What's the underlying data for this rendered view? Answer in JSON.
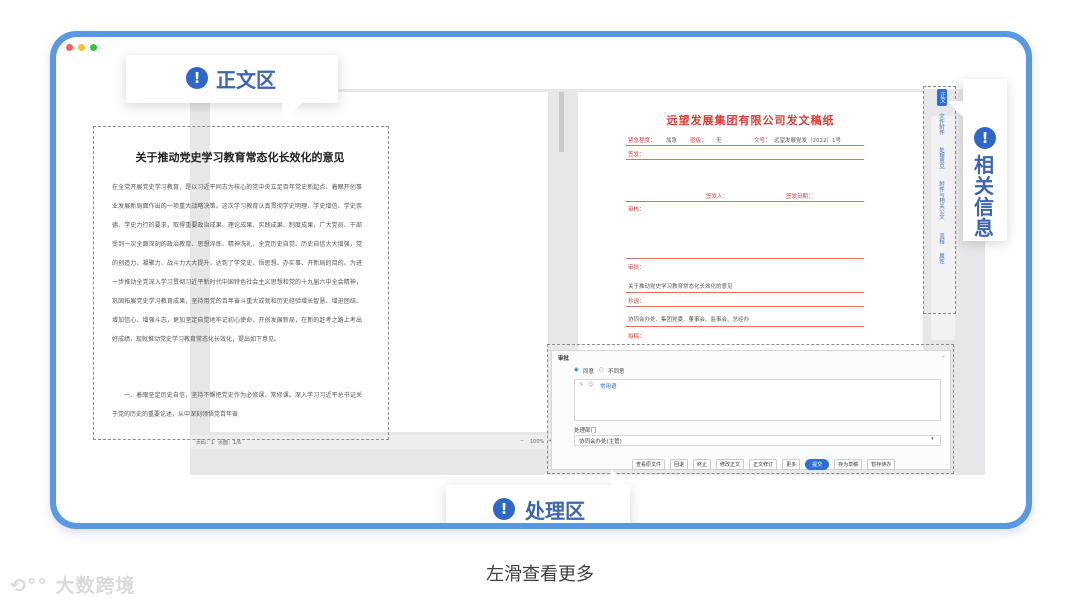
{
  "callouts": {
    "main": "正文区",
    "related": "相关信息",
    "process": "处理区"
  },
  "caption": "左滑查看更多",
  "watermark": "大数跨境",
  "doc": {
    "title": "关于推动党史学习教育常态化长效化的意见",
    "paragraphs": [
      "在全党开展党史学习教育，是以习近平同志为核心的党中央立足百年党史新起点、着眼开创事业发展新局面作出的一项重大战略决策。这次学习教育认真贯彻学史明理、学史增信、学史崇德、学史力行的要求，取得重要政治成果、理论成果、实践成果、制度成果，广大党员、干部受到一次全面深刻的政治教育、思想淬炼、精神洗礼，全党历史自觉、历史自信大大增强，党的创造力、凝聚力、战斗力大大提升，达到了学党史、悟思想、办实事、开新局的目的。为进一步推动全党深入学习贯彻习近平新时代中国特色社会主义思想和党的十九届六中全会精神，巩固拓展党史学习教育成果，坚持用党的百年奋斗重大成就和历史经验增长智慧、增进团结、增加信心、增强斗志，更加坚定自觉地牢记初心使命、开创发展新局，在新的赶考之路上考出好成绩，现就推动党史学习教育常态化长效化，提出如下意见。",
      "一、着眼坚定历史自信，坚持不懈把党史作为必修课、常修课。深入学习习近平总书记关于党的历史的重要论述，从中深刻领悟党百年奋"
    ],
    "status_page": "页码：1",
    "status_pages": "页面：1/6",
    "zoom": "100%"
  },
  "sheet": {
    "title": "远望发展集团有限公司发文稿纸",
    "fields": {
      "urgency": "紧急程度：",
      "urgency_val": "加急",
      "secret": "密级：",
      "secret_val": "无",
      "doc_no": "文号：",
      "doc_no_val": "远望发展党发〔2022〕1号",
      "signer": "签发：",
      "drafter": "签发人：",
      "sign_date": "签发日期：",
      "review": "审核：",
      "approve": "审批：",
      "subject_label": "关于推动党史学习教育常态化长效化的意见",
      "recipients": "抄送：",
      "cc_label": "协同会办处、集团党委、董事会、监事会、总经办",
      "drafting": "拟稿："
    }
  },
  "related_tabs": [
    "正文",
    "文件附件",
    "处理意见",
    "附件与相关公文",
    "流程",
    "属性"
  ],
  "process": {
    "header": "审批",
    "opt_agree": "同意",
    "opt_disagree": "不同意",
    "comment_hint": "常用语",
    "handle_label": "处理部门",
    "handle_value": "协同会办处(主管)",
    "buttons": [
      "查看原文件",
      "回退",
      "终止",
      "修改正文",
      "正文修订",
      "更多",
      "提交",
      "存为草稿",
      "暂存待办"
    ]
  },
  "colors": {
    "frame": "#5a98e6",
    "accent": "#2f6fd6",
    "label": "#3b64b4",
    "red": "#e23a34"
  }
}
